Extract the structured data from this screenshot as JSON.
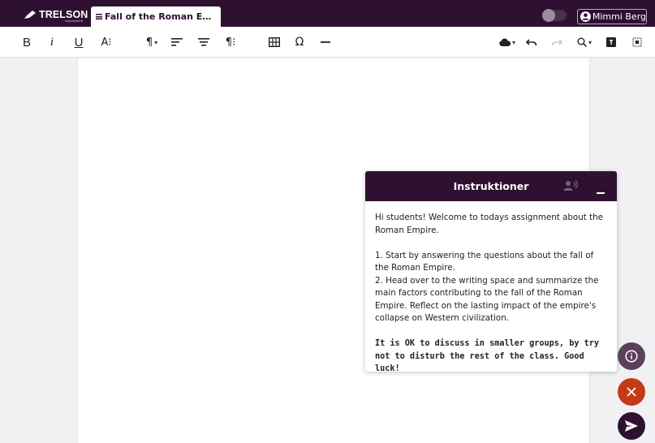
{
  "header": {
    "brand": "TRELSON",
    "brand_sub": "Assessment",
    "doc_tab_title": "Fall of the Roman E…",
    "user_name": "Mimmi Berg"
  },
  "toolbar": {
    "bold_label": "B",
    "italic_label": "i",
    "underline_label": "U",
    "font_size_label": "A⁝",
    "paragraph_label": "¶",
    "pilcrow_label": "¶⁝",
    "special_chars_label": "Ω"
  },
  "instructions": {
    "title": "Instruktioner",
    "intro": "Hi students! Welcome to todays assignment about the Roman Empire.",
    "step1": "1. Start by answering the questions about the fall of the Roman Empire.",
    "step2": "2. Head over to the writing space and summarize the main factors contributing to the fall of the Roman Empire. Reflect on the lasting impact of the empire's collapse on Western civilization.",
    "note": "It is OK to discuss in smaller groups, by try not to disturb the rest of the class. Good luck!"
  },
  "colors": {
    "brand_dark": "#2e1130",
    "info_button": "#5d3f5e",
    "close_button": "#c33b16"
  },
  "icons": [
    "pen-logo-icon",
    "document-icon",
    "user-icon",
    "align-icon",
    "center-align-icon",
    "table-icon",
    "horizontal-rule-icon",
    "cloud-save-icon",
    "undo-icon",
    "redo-icon",
    "zoom-icon",
    "text-box-icon",
    "grid-icon",
    "speech-icon",
    "minimize-icon",
    "info-icon",
    "close-icon",
    "send-icon"
  ]
}
